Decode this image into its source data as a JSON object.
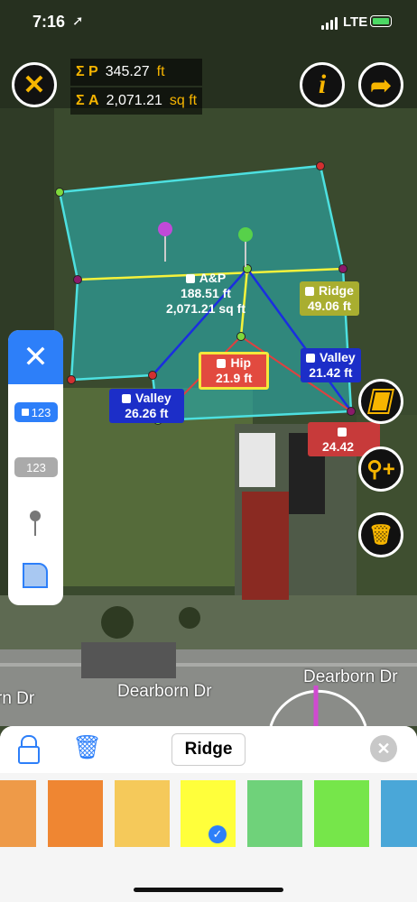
{
  "status_bar": {
    "time": "7:16",
    "location_arrow": "location-arrow-icon",
    "carrier": "LTE"
  },
  "summary": {
    "perimeter_symbol": "Σ P",
    "perimeter_value": "345.27",
    "perimeter_unit": "ft",
    "area_symbol": "Σ A",
    "area_value": "2,071.21",
    "area_unit": "sq ft"
  },
  "top_buttons": {
    "close": "close-icon",
    "info": "i",
    "share": "share-arrow-icon"
  },
  "labels": {
    "ap_title": "A&P",
    "ap_perimeter": "188.51 ft",
    "ap_area": "2,071.21 sq ft",
    "ridge_title": "Ridge",
    "ridge_value": "49.06 ft",
    "hip_title": "Hip",
    "hip_value": "21.9 ft",
    "valley_right_title": "Valley",
    "valley_right_value": "21.42 ft",
    "valley_left_title": "Valley",
    "valley_left_value": "26.26 ft",
    "red_value": "24.42"
  },
  "streets": {
    "left": "rn Dr",
    "center": "Dearborn Dr",
    "right": "Dearborn Dr"
  },
  "left_panel": {
    "chip_active": "123",
    "chip_inactive": "123"
  },
  "bottom_bar": {
    "selected_name": "Ridge"
  },
  "colors": {
    "accent_blue": "#2d7ff9",
    "gold": "#f7b500",
    "outline": "#4de0e0",
    "swatches": [
      "#ee9a48",
      "#ef8632",
      "#f5c95a",
      "#ffff3b",
      "#6fd27a",
      "#76e64a",
      "#4aa7d8"
    ],
    "selected_swatch": "#ffff3b"
  }
}
